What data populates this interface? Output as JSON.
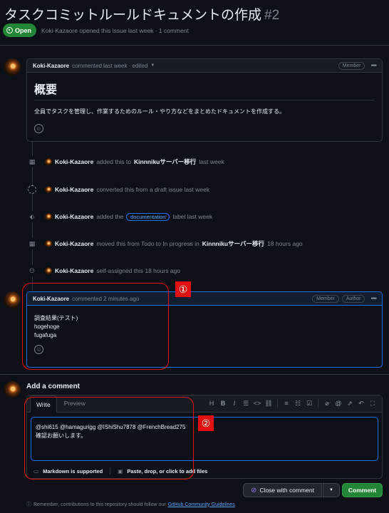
{
  "issue": {
    "title": "タスクコミットルールドキュメントの作成",
    "number": "#2",
    "status": "Open",
    "meta": "Koki-Kazaore opened this issue last week · 1 comment"
  },
  "first_comment": {
    "author": "Koki-Kazaore",
    "info": "commented last week · edited",
    "badge": "Member",
    "heading": "概要",
    "body": "全員でタスクを管理し、作業するためのルール・やり方などをまとめたドキュメントを作成する。"
  },
  "timeline": [
    {
      "icon": "project-icon",
      "actor": "Koki-Kazaore",
      "text": "added this to",
      "target": "Kinnnikuサーバー移行",
      "time": "last week"
    },
    {
      "icon": "draft-icon",
      "actor": "Koki-Kazaore",
      "text": "converted this from a draft issue last week"
    },
    {
      "icon": "tag-icon",
      "actor": "Koki-Kazaore",
      "text": "added the",
      "label": "documentation",
      "time": "label last week"
    },
    {
      "icon": "project-icon",
      "actor": "Koki-Kazaore",
      "text": "moved this from Todo to In progress in",
      "target": "Kinnnikuサーバー移行",
      "time": "18 hours ago"
    },
    {
      "icon": "person-icon",
      "actor": "Koki-Kazaore",
      "text": "self-assigned this 18 hours ago"
    }
  ],
  "second_comment": {
    "author": "Koki-Kazaore",
    "info": "commented 2 minutes ago",
    "badge1": "Member",
    "badge2": "Author",
    "lines": [
      "調査結果(テスト)",
      "hogehoge",
      "fugafuga"
    ]
  },
  "annotations": {
    "one": "①",
    "two": "②"
  },
  "add_comment": {
    "title": "Add a comment",
    "tab_write": "Write",
    "tab_preview": "Preview",
    "text_line1": "@shi615 @hamagurigg @IShiShu7878 @FrenchBread275",
    "text_line2": "確認お願いします。",
    "markdown_note": "Markdown is supported",
    "attach_note": "Paste, drop, or click to add files",
    "close_button": "Close with comment",
    "comment_button": "Comment",
    "footer_prefix": "Remember, contributions to this repository should follow our",
    "footer_link": "GitHub Community Guidelines",
    "footer_suffix": "."
  },
  "toolbar_icons": [
    "heading-icon",
    "bold-icon",
    "italic-icon",
    "quote-icon",
    "code-icon",
    "link-icon",
    "numbered-list-icon",
    "bullet-list-icon",
    "task-list-icon",
    "attach-icon",
    "mention-icon",
    "reference-icon",
    "reply-icon",
    "fullscreen-icon"
  ],
  "colors": {
    "accent": "#238636",
    "link": "#58a6ff",
    "annotation": "#e01010"
  }
}
